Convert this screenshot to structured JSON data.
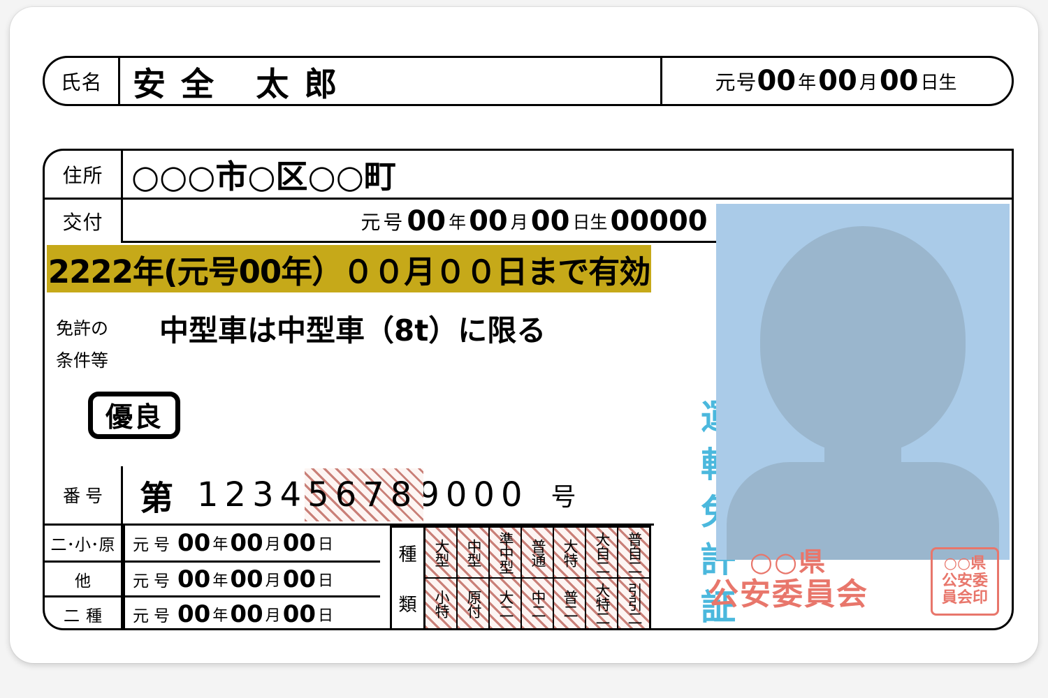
{
  "card": {
    "name": {
      "label": "氏名",
      "value": "安全 太郎"
    },
    "birth": {
      "era": "元号",
      "year": "00",
      "year_unit": "年",
      "month": "00",
      "month_unit": "月",
      "day": "00",
      "day_unit": "日生"
    },
    "address": {
      "label": "住所",
      "value": "○○○市○区○○町"
    },
    "issue": {
      "label": "交付",
      "era": "元号",
      "year": "00",
      "year_unit": "年",
      "month": "00",
      "month_unit": "月",
      "day": "00",
      "day_unit": "日生",
      "code": "00000"
    },
    "expiry": {
      "text": "2222年(元号00年）００月００日まで有効",
      "bar_color": "#c6a919"
    },
    "conditions": {
      "label_line1": "免許の",
      "label_line2": "条件等",
      "value": "中型車は中型車（8t）に限る"
    },
    "badge": {
      "text": "優良"
    },
    "number": {
      "label": "番号",
      "prefix": "第",
      "digits_plain_1": "1234",
      "digits_hatched": "5678",
      "digits_plain_2": "9000",
      "suffix": "号"
    },
    "dates": [
      {
        "label": "二･小･原",
        "era": "元号",
        "year": "00",
        "year_unit": "年",
        "month": "00",
        "month_unit": "月",
        "day": "00",
        "day_unit": "日"
      },
      {
        "label": "他",
        "era": "元号",
        "year": "00",
        "year_unit": "年",
        "month": "00",
        "month_unit": "月",
        "day": "00",
        "day_unit": "日"
      },
      {
        "label": "二種",
        "era": "元号",
        "year": "00",
        "year_unit": "年",
        "month": "00",
        "month_unit": "月",
        "day": "00",
        "day_unit": "日"
      }
    ],
    "categories": {
      "head_top": "種",
      "head_bottom": "類",
      "row_top": [
        "大型",
        "中型",
        "準中型",
        "普通",
        "大特",
        "大自二",
        "普自二"
      ],
      "row_bottom": [
        "小特",
        "原付",
        "大二",
        "中二",
        "普二",
        "大特二",
        "引引二"
      ],
      "hatch_color": "#c97f77"
    },
    "vertical_title": {
      "text": "運転免許証",
      "color": "#4bb8dd"
    },
    "photo": {
      "bg_color": "#aacbe8",
      "silhouette_color": "#9ab6cd"
    },
    "issuer": {
      "line1": "○○県",
      "line2": "公安委員会",
      "color": "#e8766b"
    },
    "seal": {
      "line1": "○○県",
      "line2": "公安委",
      "line3": "員会印"
    }
  }
}
